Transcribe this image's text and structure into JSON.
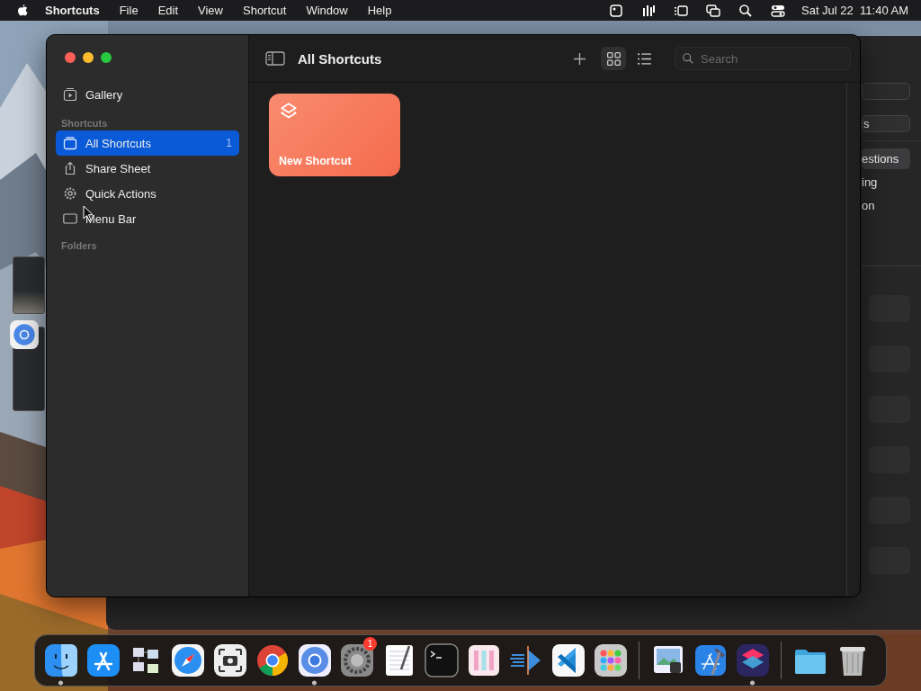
{
  "menu_bar": {
    "app_name": "Shortcuts",
    "menus": [
      "File",
      "Edit",
      "View",
      "Shortcut",
      "Window",
      "Help"
    ],
    "clock": "Sat Jul 22  11:40 AM"
  },
  "main_window": {
    "sidebar": {
      "top_items": [
        {
          "label": "Gallery",
          "kind": "gallery"
        }
      ],
      "sections": [
        {
          "title": "Shortcuts",
          "items": [
            {
              "label": "All Shortcuts",
              "kind": "stack",
              "count": "1",
              "selected": true
            },
            {
              "label": "Share Sheet",
              "kind": "share",
              "selected": false
            },
            {
              "label": "Quick Actions",
              "kind": "gear",
              "selected": false
            },
            {
              "label": "Menu Bar",
              "kind": "menubar",
              "selected": false
            }
          ]
        },
        {
          "title": "Folders"
        }
      ]
    },
    "toolbar": {
      "title": "All Shortcuts",
      "views": [
        {
          "kind": "grid",
          "selected": true
        },
        {
          "kind": "list",
          "selected": false
        }
      ],
      "search": {
        "placeholder": "Search"
      }
    },
    "shortcuts": [
      {
        "name": "New Shortcut"
      }
    ]
  },
  "background_window": {
    "fields": [
      {
        "kind": "empty"
      },
      {
        "kind": "text",
        "value": "s"
      }
    ],
    "list": [
      {
        "label": "estions",
        "selected": true
      },
      {
        "label": "ing",
        "selected": false
      },
      {
        "label": "on",
        "selected": false
      }
    ]
  },
  "dock": {
    "groups": [
      [
        {
          "kind": "finder",
          "running": true
        },
        {
          "kind": "appstore",
          "running": false
        },
        {
          "kind": "windows",
          "running": false
        },
        {
          "kind": "safari",
          "running": false
        },
        {
          "kind": "screenshot",
          "running": false
        },
        {
          "kind": "chrome",
          "running": false
        },
        {
          "kind": "chromium",
          "running": true
        },
        {
          "kind": "settings",
          "running": false,
          "badge": "1"
        },
        {
          "kind": "textedit",
          "running": false
        },
        {
          "kind": "terminal",
          "running": false
        },
        {
          "kind": "columns",
          "running": false
        },
        {
          "kind": "instruments",
          "running": false
        },
        {
          "kind": "vscode",
          "running": false
        },
        {
          "kind": "launchpad",
          "running": false
        }
      ],
      [
        {
          "kind": "preview",
          "running": false
        },
        {
          "kind": "xcode",
          "running": false
        },
        {
          "kind": "shortcuts",
          "running": true
        }
      ],
      [
        {
          "kind": "folder",
          "running": false
        },
        {
          "kind": "trash",
          "running": false
        }
      ]
    ]
  }
}
